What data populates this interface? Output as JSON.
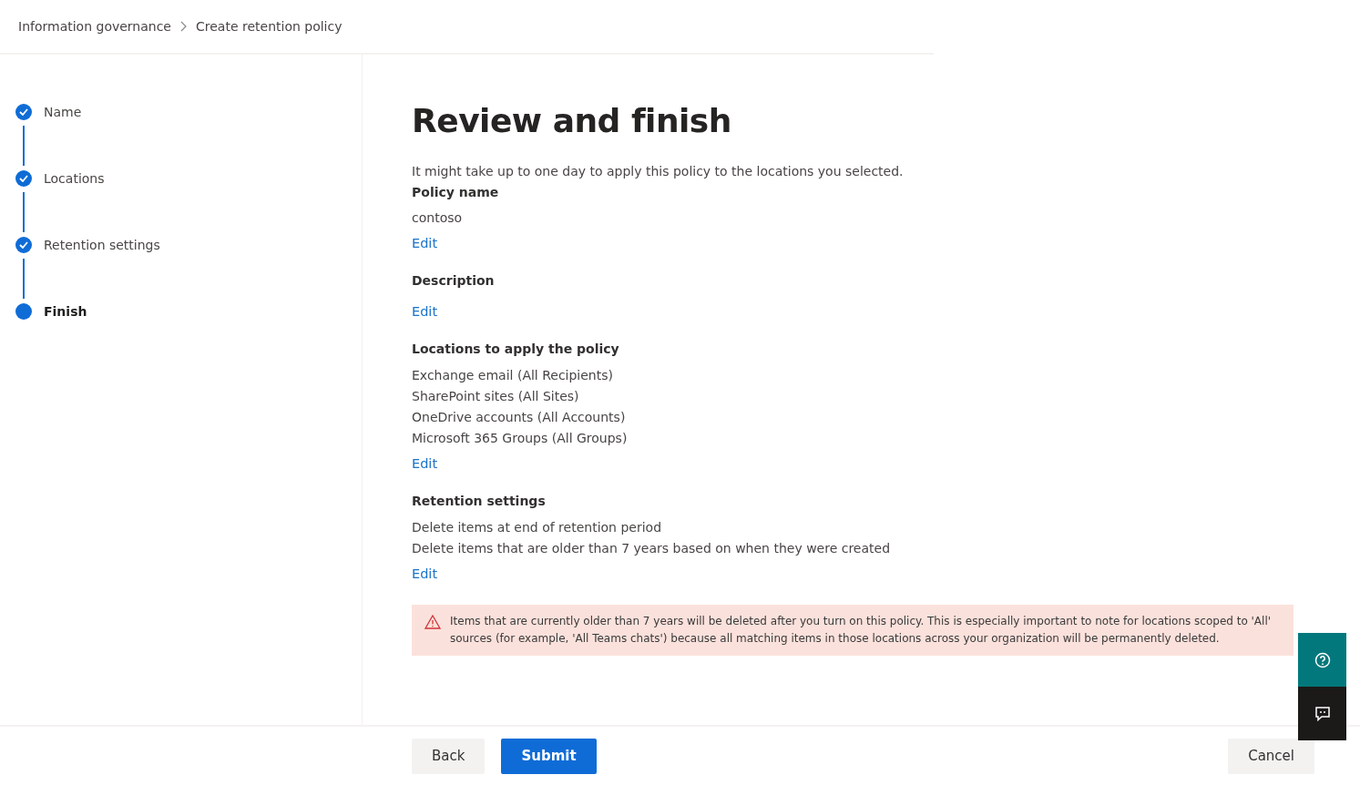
{
  "breadcrumb": [
    "Information governance",
    "Create retention policy"
  ],
  "steps": [
    {
      "label": "Name",
      "completed": true,
      "selected": false
    },
    {
      "label": "Locations",
      "completed": true,
      "selected": false
    },
    {
      "label": "Retention settings",
      "completed": true,
      "selected": false
    },
    {
      "label": "Finish",
      "completed": false,
      "selected": true
    }
  ],
  "title": "Review and finish",
  "intro": "It might take up to one day to apply this policy to the locations you selected.",
  "sections": [
    {
      "heading": "Policy name",
      "lines": [
        "contoso"
      ],
      "edit": "Edit"
    },
    {
      "heading": "Description",
      "edit": "Edit"
    },
    {
      "heading": "Locations to apply the policy",
      "lines": [
        "Exchange email (All Recipients)",
        "SharePoint sites (All Sites)",
        "OneDrive accounts (All Accounts)",
        "Microsoft 365 Groups (All Groups)"
      ],
      "edit": "Edit"
    },
    {
      "heading": "Retention settings",
      "lines": [
        "Delete items at end of retention period",
        "Delete items that are older than 7 years based on when they were created"
      ],
      "edit": "Edit"
    }
  ],
  "warning": "Items that are currently older than 7 years will be deleted after you turn on this policy. This is especially important to note for locations scoped to 'All' sources (for example, 'All Teams chats') because all matching items in those locations across your organization will be permanently deleted.",
  "buttons": {
    "back": "Back",
    "submit": "Submit",
    "cancel": "Cancel"
  }
}
